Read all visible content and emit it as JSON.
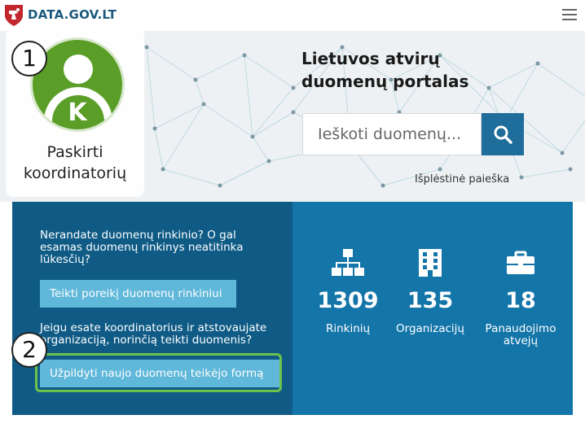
{
  "header": {
    "site_name_main": "DATA",
    "site_name_tld": ".GOV.LT"
  },
  "hero": {
    "title_line1": "Lietuvos atvirų",
    "title_line2": "duomenų portalas",
    "search_placeholder": "Ieškoti duomenų...",
    "advanced_search": "Išplėstinė paieška"
  },
  "coordinator": {
    "avatar_letter": "K",
    "label_line1": "Paskirti",
    "label_line2": "koordinatorių"
  },
  "badges": {
    "step1": "1",
    "step2": "2"
  },
  "info": {
    "question": "Nerandate duomenų rinkinio? O gal esamas duomenų rinkinys neatitinka lūkesčių?",
    "request_button": "Teikti poreikį duomenų rinkiniui",
    "coordinator_text": "Jeigu esate koordinatorius ir atstovaujate organizaciją, norinčią teikti duomenis?",
    "form_button": "Užpildyti naujo duomenų teikėjo formą"
  },
  "stats": [
    {
      "value": "1309",
      "label": "Rinkinių",
      "icon": "sitemap-icon"
    },
    {
      "value": "135",
      "label": "Organizacijų",
      "icon": "building-icon"
    },
    {
      "value": "18",
      "label": "Panaudojimo atvejų",
      "icon": "briefcase-icon"
    }
  ],
  "colors": {
    "brand": "#1b5a7d",
    "left_panel": "#0f5b86",
    "right_panel": "#1475a9",
    "button": "#5fb7d9",
    "avatar": "#5a9e28",
    "highlight": "#6cc24a"
  }
}
